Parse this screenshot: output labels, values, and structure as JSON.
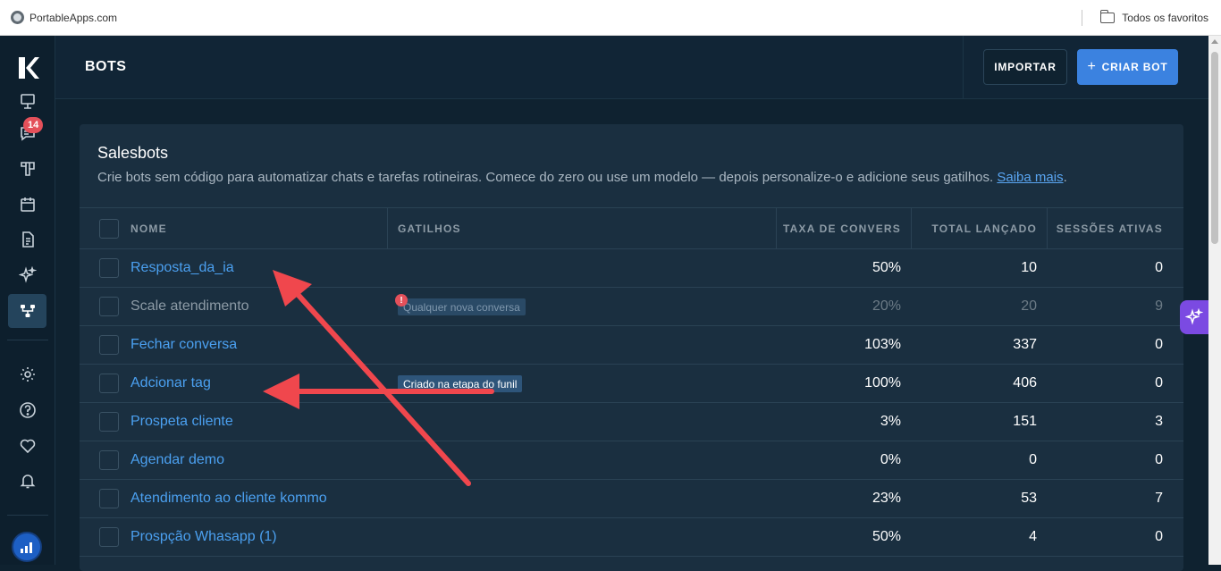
{
  "browser": {
    "bookmark_left": "PortableApps.com",
    "bookmark_right": "Todos os favoritos"
  },
  "sidebar": {
    "chat_badge": "14",
    "items": [
      {
        "icon": "dashboard-icon"
      },
      {
        "icon": "chat-icon"
      },
      {
        "icon": "pipeline-icon"
      },
      {
        "icon": "calendar-icon"
      },
      {
        "icon": "document-icon"
      },
      {
        "icon": "sparkles-icon"
      },
      {
        "icon": "automation-icon",
        "active": true
      },
      {
        "icon": "settings-icon"
      },
      {
        "icon": "help-icon"
      },
      {
        "icon": "heart-icon"
      },
      {
        "icon": "bell-icon"
      }
    ]
  },
  "header": {
    "title": "BOTS",
    "import_label": "IMPORTAR",
    "create_label": "CRIAR BOT",
    "create_prefix": "+"
  },
  "card": {
    "title": "Salesbots",
    "description": "Crie bots sem código para automatizar chats e tarefas rotineiras. Comece do zero ou use um modelo — depois personalize-o e adicione seus gatilhos.",
    "learn_more": "Saiba mais",
    "period": "."
  },
  "table": {
    "columns": [
      "NOME",
      "GATILHOS",
      "TAXA DE CONVERS",
      "TOTAL LANÇADO",
      "SESSÕES ATIVAS"
    ],
    "rows": [
      {
        "name": "Resposta_da_ia",
        "trigger": "",
        "rate": "50%",
        "total": "10",
        "sessions": "0"
      },
      {
        "name": "Scale atendimento",
        "trigger": "Qualquer nova conversa",
        "rate": "20%",
        "total": "20",
        "sessions": "9",
        "disabled": true
      },
      {
        "name": "Fechar conversa",
        "trigger": "",
        "rate": "103%",
        "total": "337",
        "sessions": "0"
      },
      {
        "name": "Adcionar tag",
        "trigger": "Criado na etapa do funil",
        "rate": "100%",
        "total": "406",
        "sessions": "0"
      },
      {
        "name": "Prospeta cliente",
        "trigger": "",
        "rate": "3%",
        "total": "151",
        "sessions": "3"
      },
      {
        "name": "Agendar demo",
        "trigger": "",
        "rate": "0%",
        "total": "0",
        "sessions": "0"
      },
      {
        "name": "Atendimento ao cliente kommo",
        "trigger": "",
        "rate": "23%",
        "total": "53",
        "sessions": "7"
      },
      {
        "name": "Prospção Whasapp (1)",
        "trigger": "",
        "rate": "50%",
        "total": "4",
        "sessions": "0"
      }
    ]
  },
  "colors": {
    "accent": "#3b82e0",
    "link": "#4ba0f0",
    "annotation_arrow": "#f0474d",
    "badge": "#e4505a",
    "ai_button": "#7b4ae2"
  }
}
